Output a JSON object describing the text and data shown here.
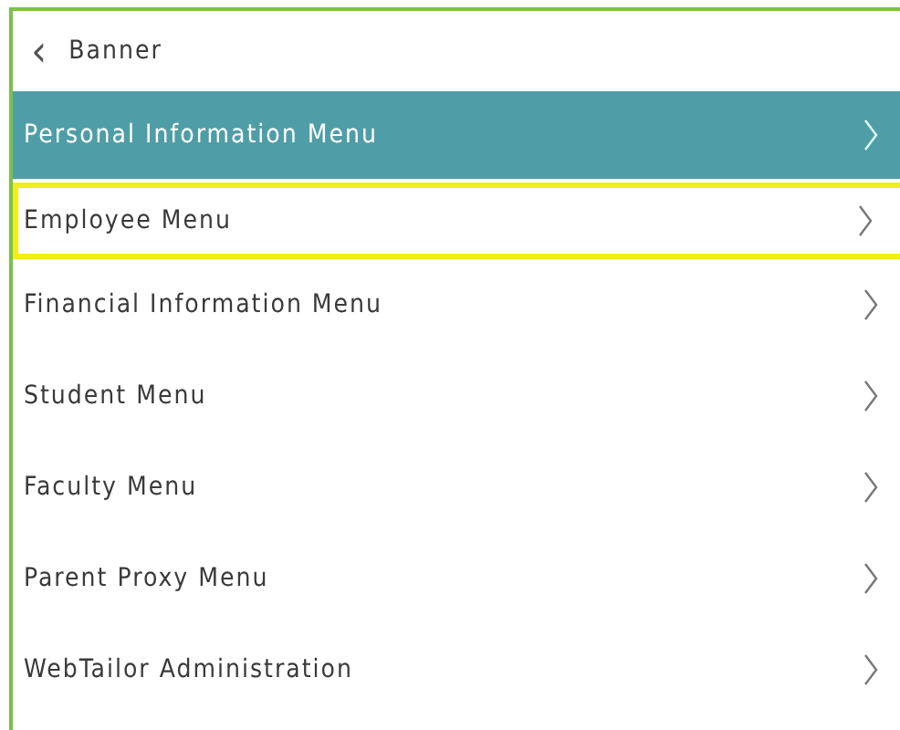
{
  "header": {
    "back_icon": "‹",
    "title": "Banner"
  },
  "menu": [
    {
      "label": "Personal Information Menu",
      "selected": true,
      "focused": false
    },
    {
      "label": "Employee Menu",
      "selected": false,
      "focused": true
    },
    {
      "label": "Financial Information Menu",
      "selected": false,
      "focused": false
    },
    {
      "label": "Student Menu",
      "selected": false,
      "focused": false
    },
    {
      "label": "Faculty Menu",
      "selected": false,
      "focused": false
    },
    {
      "label": "Parent Proxy Menu",
      "selected": false,
      "focused": false
    },
    {
      "label": "WebTailor Administration",
      "selected": false,
      "focused": false
    }
  ]
}
